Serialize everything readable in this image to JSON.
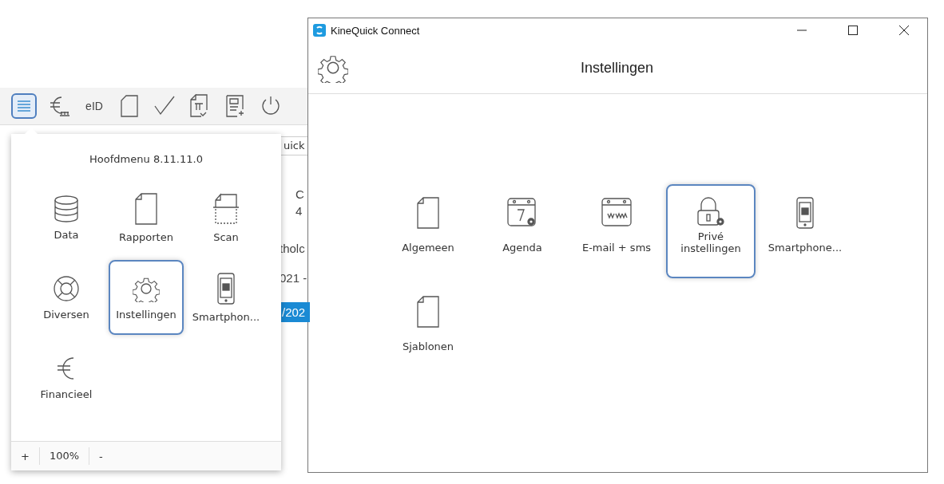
{
  "toolbar": {
    "items": [
      {
        "selected": true
      },
      {
        "selected": false
      },
      {
        "label": "eID",
        "selected": false
      },
      {
        "selected": false
      },
      {
        "selected": false
      },
      {
        "selected": false
      },
      {
        "selected": false
      },
      {
        "selected": false
      }
    ]
  },
  "background_app": {
    "field_value": "uick",
    "rows": [
      "C",
      "4",
      "tholc",
      "021 -"
    ],
    "selected_row": "/202"
  },
  "main_menu": {
    "title": "Hoofdmenu 8.11.11.0",
    "items": [
      {
        "label": "Data",
        "selected": false
      },
      {
        "label": "Rapporten",
        "selected": false
      },
      {
        "label": "Scan",
        "selected": false
      },
      {
        "label": "Diversen",
        "selected": false
      },
      {
        "label": "Instellingen",
        "selected": true
      },
      {
        "label": "Smartphon...",
        "selected": false
      },
      {
        "label": "Financieel",
        "selected": false
      }
    ],
    "zoom": {
      "plus": "+",
      "value": "100%",
      "minus": "-"
    }
  },
  "window": {
    "title": "KineQuick Connect",
    "heading": "Instellingen",
    "items": [
      {
        "label": "Algemeen",
        "selected": false
      },
      {
        "label": "Agenda",
        "selected": false
      },
      {
        "label": "E-mail + sms",
        "selected": false
      },
      {
        "label": "Privé instellingen",
        "selected": true
      },
      {
        "label": "Smartphone...",
        "selected": false
      },
      {
        "label": "Sjablonen",
        "selected": false
      }
    ]
  }
}
